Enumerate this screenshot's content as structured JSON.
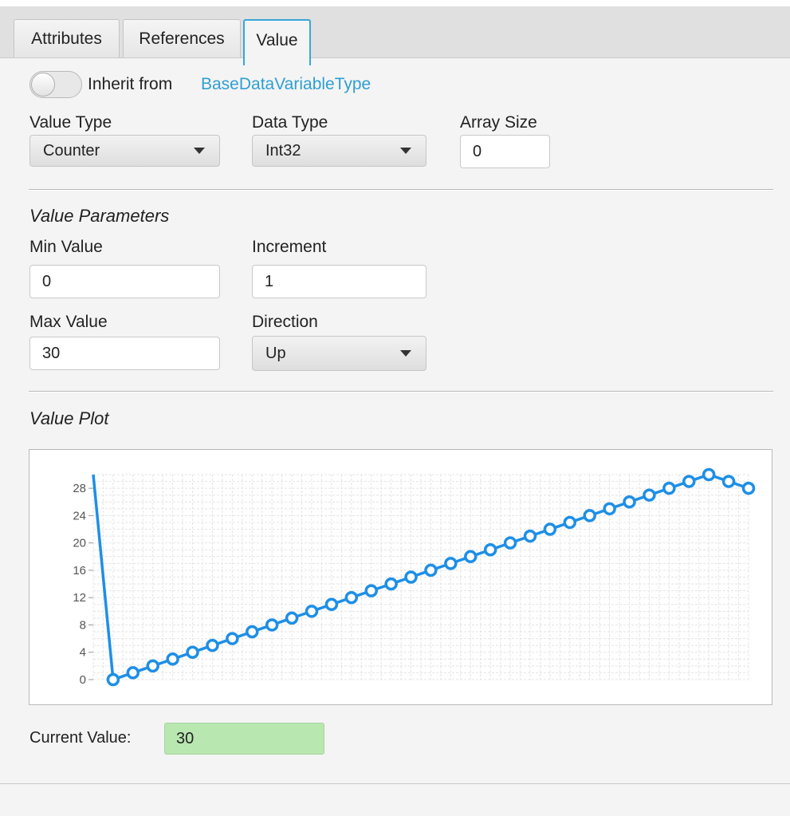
{
  "tabs": [
    {
      "label": "Attributes",
      "active": false
    },
    {
      "label": "References",
      "active": false
    },
    {
      "label": "Value",
      "active": true
    }
  ],
  "inherit": {
    "label": "Inherit from",
    "type_link": "BaseDataVariableType",
    "toggle_on": false
  },
  "value_type": {
    "label": "Value Type",
    "selected": "Counter"
  },
  "data_type": {
    "label": "Data Type",
    "selected": "Int32"
  },
  "array_size": {
    "label": "Array Size",
    "value": "0"
  },
  "params": {
    "heading": "Value Parameters",
    "min_label": "Min Value",
    "min_value": "0",
    "increment_label": "Increment",
    "increment_value": "1",
    "max_label": "Max Value",
    "max_value": "30",
    "direction_label": "Direction",
    "direction_selected": "Up"
  },
  "plot": {
    "heading": "Value Plot"
  },
  "current": {
    "label": "Current Value:",
    "value": "30"
  },
  "colors": {
    "accent": "#37a6d6",
    "series": "#1e8fe6",
    "current_bg": "#b9e7b0",
    "link": "#2f9fd3"
  },
  "chart_data": {
    "type": "line",
    "x": [
      0,
      1,
      2,
      3,
      4,
      5,
      6,
      7,
      8,
      9,
      10,
      11,
      12,
      13,
      14,
      15,
      16,
      17,
      18,
      19,
      20,
      21,
      22,
      23,
      24,
      25,
      26,
      27,
      28,
      29,
      30,
      31,
      32,
      33
    ],
    "series": [
      {
        "values": [
          30,
          0,
          1,
          2,
          3,
          4,
          5,
          6,
          7,
          8,
          9,
          10,
          11,
          12,
          13,
          14,
          15,
          16,
          17,
          18,
          19,
          20,
          21,
          22,
          23,
          24,
          25,
          26,
          27,
          28,
          29,
          30,
          29,
          28
        ]
      }
    ],
    "y_ticks": [
      "0",
      "4",
      "8",
      "12",
      "16",
      "20",
      "24",
      "28"
    ],
    "ylim": [
      0,
      30
    ],
    "grid": true
  }
}
